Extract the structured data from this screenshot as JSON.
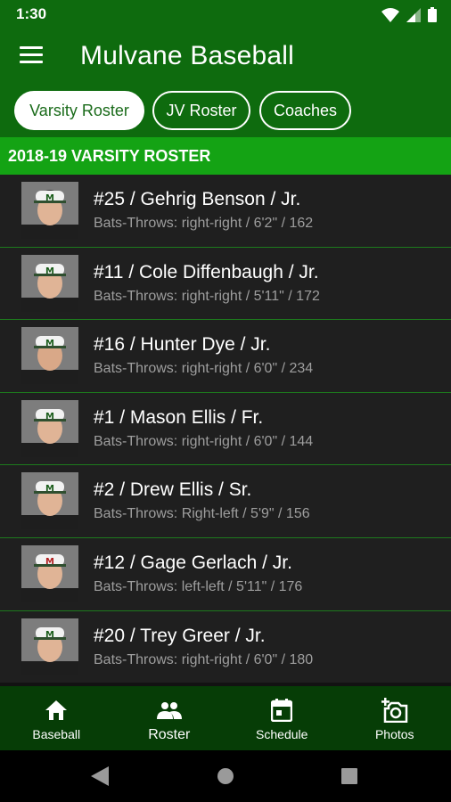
{
  "status": {
    "time": "1:30",
    "icons": [
      "wifi-icon",
      "signal-icon",
      "battery-icon"
    ]
  },
  "app": {
    "title": "Mulvane Baseball",
    "menu_icon": "menu-icon"
  },
  "tabs": [
    {
      "label": "Varsity Roster",
      "active": true
    },
    {
      "label": "JV Roster",
      "active": false
    },
    {
      "label": "Coaches",
      "active": false
    }
  ],
  "section": {
    "title": "2018-19 VARSITY ROSTER"
  },
  "players": [
    {
      "name": "#25 / Gehrig Benson / Jr.",
      "detail": "Bats-Throws: right-right / 6'2\" / 162"
    },
    {
      "name": "#11 / Cole Diffenbaugh / Jr.",
      "detail": "Bats-Throws: right-right / 5'11\" / 172"
    },
    {
      "name": "#16 / Hunter Dye / Jr.",
      "detail": "Bats-Throws: right-right / 6'0\" / 234"
    },
    {
      "name": "#1 / Mason Ellis / Fr.",
      "detail": "Bats-Throws: right-right / 6'0\" / 144"
    },
    {
      "name": "#2 / Drew Ellis / Sr.",
      "detail": "Bats-Throws: Right-left / 5'9\" / 156"
    },
    {
      "name": "#12 / Gage Gerlach / Jr.",
      "detail": "Bats-Throws: left-left / 5'11\" / 176"
    },
    {
      "name": "#20 / Trey Greer / Jr.",
      "detail": "Bats-Throws: right-right / 6'0\" / 180"
    }
  ],
  "bottom_nav": [
    {
      "label": "Baseball",
      "icon": "home-icon",
      "active": false
    },
    {
      "label": "Roster",
      "icon": "people-icon",
      "active": true
    },
    {
      "label": "Schedule",
      "icon": "calendar-icon",
      "active": false
    },
    {
      "label": "Photos",
      "icon": "add-photo-icon",
      "active": false
    }
  ],
  "colors": {
    "primary": "#0e6b0e",
    "section": "#14a314",
    "nav": "#063d06",
    "row": "#1f1f1f"
  }
}
